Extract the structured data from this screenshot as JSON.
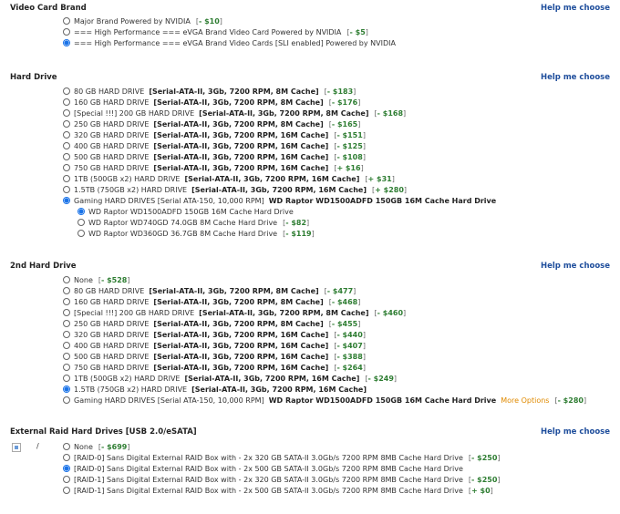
{
  "help_label": "Help me choose",
  "video_card": {
    "title": "Video Card Brand",
    "options": [
      {
        "label": "Major Brand Powered by NVIDIA",
        "price": "- $10",
        "selected": false
      },
      {
        "label": "=== High Performance === eVGA Brand Video Card Powered by NVIDIA",
        "price": "- $5",
        "selected": false
      },
      {
        "label": "=== High Performance === eVGA Brand Video Cards [SLI enabled] Powered by NVIDIA",
        "price": "",
        "selected": true
      }
    ]
  },
  "hard_drive": {
    "title": "Hard Drive",
    "options": [
      {
        "label": "80 GB HARD DRIVE",
        "spec": "[Serial-ATA-II, 3Gb, 7200 RPM, 8M Cache]",
        "price": "- $183"
      },
      {
        "label": "160 GB HARD DRIVE",
        "spec": "[Serial-ATA-II, 3Gb, 7200 RPM, 8M Cache]",
        "price": "- $176"
      },
      {
        "label": "[Special !!!] 200 GB HARD DRIVE",
        "spec": "[Serial-ATA-II, 3Gb, 7200 RPM, 8M Cache]",
        "price": "- $168"
      },
      {
        "label": "250 GB HARD DRIVE",
        "spec": "[Serial-ATA-II, 3Gb, 7200 RPM, 8M Cache]",
        "price": "- $165"
      },
      {
        "label": "320 GB HARD DRIVE",
        "spec": "[Serial-ATA-II, 3Gb, 7200 RPM, 16M Cache]",
        "price": "- $151"
      },
      {
        "label": "400 GB HARD DRIVE",
        "spec": "[Serial-ATA-II, 3Gb, 7200 RPM, 16M Cache]",
        "price": "- $125"
      },
      {
        "label": "500 GB HARD DRIVE",
        "spec": "[Serial-ATA-II, 3Gb, 7200 RPM, 16M Cache]",
        "price": "- $108"
      },
      {
        "label": "750 GB HARD DRIVE",
        "spec": "[Serial-ATA-II, 3Gb, 7200 RPM, 16M Cache]",
        "price": "+ $16"
      },
      {
        "label": "1TB (500GB x2) HARD DRIVE",
        "spec": "[Serial-ATA-II, 3Gb, 7200 RPM, 16M Cache]",
        "price": "+ $31"
      },
      {
        "label": "1.5TB (750GB x2) HARD DRIVE",
        "spec": "[Serial-ATA-II, 3Gb, 7200 RPM, 16M Cache]",
        "price": "+ $280"
      },
      {
        "label": "Gaming HARD DRIVES [Serial ATA-150, 10,000 RPM]",
        "spec": "WD Raptor WD1500ADFD 150GB 16M Cache Hard Drive",
        "price": "",
        "selected": true
      }
    ],
    "sub_options": [
      {
        "label": "WD Raptor WD1500ADFD 150GB 16M Cache Hard Drive",
        "price": "",
        "selected": true
      },
      {
        "label": "WD Raptor WD740GD 74.0GB 8M Cache Hard Drive",
        "price": "- $82"
      },
      {
        "label": "WD Raptor WD360GD 36.7GB 8M Cache Hard Drive",
        "price": "- $119"
      }
    ]
  },
  "second_hard_drive": {
    "title": "2nd Hard Drive",
    "options": [
      {
        "label": "None",
        "spec": "",
        "price": "- $528"
      },
      {
        "label": "80 GB HARD DRIVE",
        "spec": "[Serial-ATA-II, 3Gb, 7200 RPM, 8M Cache]",
        "price": "- $477"
      },
      {
        "label": "160 GB HARD DRIVE",
        "spec": "[Serial-ATA-II, 3Gb, 7200 RPM, 8M Cache]",
        "price": "- $468"
      },
      {
        "label": "[Special !!!] 200 GB HARD DRIVE",
        "spec": "[Serial-ATA-II, 3Gb, 7200 RPM, 8M Cache]",
        "price": "- $460"
      },
      {
        "label": "250 GB HARD DRIVE",
        "spec": "[Serial-ATA-II, 3Gb, 7200 RPM, 8M Cache]",
        "price": "- $455"
      },
      {
        "label": "320 GB HARD DRIVE",
        "spec": "[Serial-ATA-II, 3Gb, 7200 RPM, 16M Cache]",
        "price": "- $440"
      },
      {
        "label": "400 GB HARD DRIVE",
        "spec": "[Serial-ATA-II, 3Gb, 7200 RPM, 16M Cache]",
        "price": "- $407"
      },
      {
        "label": "500 GB HARD DRIVE",
        "spec": "[Serial-ATA-II, 3Gb, 7200 RPM, 16M Cache]",
        "price": "- $388"
      },
      {
        "label": "750 GB HARD DRIVE",
        "spec": "[Serial-ATA-II, 3Gb, 7200 RPM, 16M Cache]",
        "price": "- $264"
      },
      {
        "label": "1TB (500GB x2) HARD DRIVE",
        "spec": "[Serial-ATA-II, 3Gb, 7200 RPM, 16M Cache]",
        "price": "- $249"
      },
      {
        "label": "1.5TB (750GB x2) HARD DRIVE",
        "spec": "[Serial-ATA-II, 3Gb, 7200 RPM, 16M Cache]",
        "price": "",
        "selected": true
      },
      {
        "label": "Gaming HARD DRIVES [Serial ATA-150, 10,000 RPM]",
        "spec": "WD Raptor WD1500ADFD 150GB 16M Cache Hard Drive",
        "more": "More Options",
        "price": "- $280"
      }
    ]
  },
  "raid": {
    "title": "External Raid Hard Drives [USB 2.0/eSATA]",
    "slash": "/",
    "options": [
      {
        "label": "None",
        "price": "- $699"
      },
      {
        "label": "[RAID-0] Sans Digital External RAID Box with - 2x 320 GB SATA-II 3.0Gb/s 7200 RPM 8MB Cache Hard Drive",
        "price": "- $250"
      },
      {
        "label": "[RAID-0] Sans Digital External RAID Box with - 2x 500 GB SATA-II 3.0Gb/s 7200 RPM 8MB Cache Hard Drive",
        "price": "",
        "selected": true
      },
      {
        "label": "[RAID-1] Sans Digital External RAID Box with - 2x 320 GB SATA-II 3.0Gb/s 7200 RPM 8MB Cache Hard Drive",
        "price": "- $250"
      },
      {
        "label": "[RAID-1] Sans Digital External RAID Box with - 2x 500 GB SATA-II 3.0Gb/s 7200 RPM 8MB Cache Hard Drive",
        "price": "+ $0"
      }
    ]
  },
  "colors": {
    "link": "#1f4e9c",
    "price": "#2e7d32",
    "more": "#e08a00",
    "radio_selected": "#1a73e8"
  }
}
